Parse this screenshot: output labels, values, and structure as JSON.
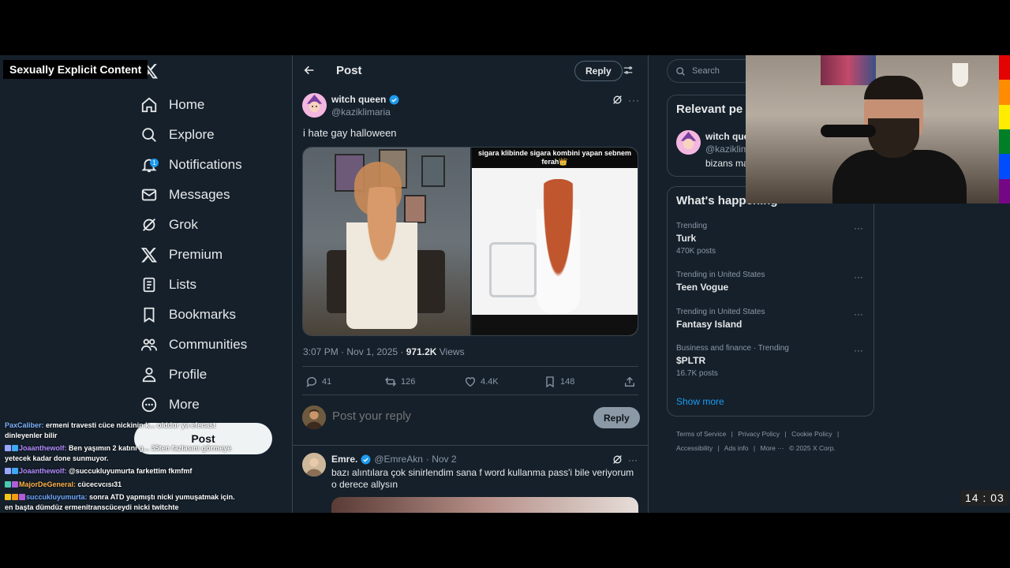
{
  "overlay": {
    "censor_label": "Sexually Explicit Content",
    "timer": "14 : 03"
  },
  "nav": {
    "items": [
      {
        "label": "Home",
        "icon": "home-icon"
      },
      {
        "label": "Explore",
        "icon": "search-icon"
      },
      {
        "label": "Notifications",
        "icon": "bell-icon",
        "badge": "1"
      },
      {
        "label": "Messages",
        "icon": "mail-icon"
      },
      {
        "label": "Grok",
        "icon": "grok-icon"
      },
      {
        "label": "Premium",
        "icon": "x-icon"
      },
      {
        "label": "Lists",
        "icon": "list-icon"
      },
      {
        "label": "Bookmarks",
        "icon": "bookmark-icon"
      },
      {
        "label": "Communities",
        "icon": "people-icon"
      },
      {
        "label": "Profile",
        "icon": "person-icon"
      },
      {
        "label": "More",
        "icon": "more-circle-icon"
      }
    ],
    "post_label": "Post"
  },
  "chat": [
    {
      "user": "PaxCaliber:",
      "text": "ermeni travesti cüce nickinin k... olddur ya efecast dinleyenler bilir"
    },
    {
      "user": "Joaanthewolf:",
      "text": "Ben yaşımın 2 katını g... 35ten fazlasını görmeye yetecek kadar done sunmuyor."
    },
    {
      "user": "Joaanthewolf:",
      "text": "@succukluyumurta farkettim fkmfmf"
    },
    {
      "user": "MajorDeGeneral:",
      "text": "cücecvcısı31"
    },
    {
      "user": "succukluyumurta:",
      "text": "sonra ATD yapmıştı nicki yumuşatmak için. en başta dümdüz ermenitranscüceydi nicki twitchte"
    }
  ],
  "header": {
    "title": "Post",
    "reply_label": "Reply"
  },
  "tweet": {
    "name": "witch queen",
    "handle": "@kaziklimaria",
    "text": "i hate gay halloween",
    "media_caption": "sigara klibinde sigara kombini yapan sebnem ferah👑",
    "time": "3:07 PM · Nov 1, 2025 · ",
    "views_count": "971.2K",
    "views_label": " Views",
    "replies": "41",
    "reposts": "126",
    "likes": "4.4K",
    "bookmarks": "148"
  },
  "composer": {
    "placeholder": "Post your reply",
    "button": "Reply"
  },
  "reply": {
    "name": "Emre.",
    "handle": "@EmreAkn",
    "date": "· Nov 2",
    "text": "bazı alıntılara çok sinirlendim sana f word kullanma pass'i bile veriyorum o derece allysın"
  },
  "sidebar": {
    "search_placeholder": "Search",
    "relevant_title": "Relevant pe",
    "relevant_name": "witch que",
    "relevant_handle": "@kaziklim",
    "relevant_bio": "bizans ma",
    "happening_title": "What's happening",
    "trends": [
      {
        "context": "Trending",
        "name": "Turk",
        "count": "470K posts"
      },
      {
        "context": "Trending in United States",
        "name": "Teen Vogue",
        "count": ""
      },
      {
        "context": "Trending in United States",
        "name": "Fantasy Island",
        "count": ""
      },
      {
        "context": "Business and finance · Trending",
        "name": "$PLTR",
        "count": "16.7K posts"
      }
    ],
    "show_more": "Show more",
    "footer_line1": [
      "Terms of Service",
      "|",
      "Privacy Policy",
      "|",
      "Cookie Policy",
      "|"
    ],
    "footer_line2": [
      "Accessibility",
      "|",
      "Ads info",
      "|",
      "More ···",
      "© 2025 X Corp."
    ]
  },
  "colors": {
    "background": "#15202b",
    "accent": "#1d9bf0",
    "border": "#38444d",
    "muted": "#8b98a5"
  }
}
